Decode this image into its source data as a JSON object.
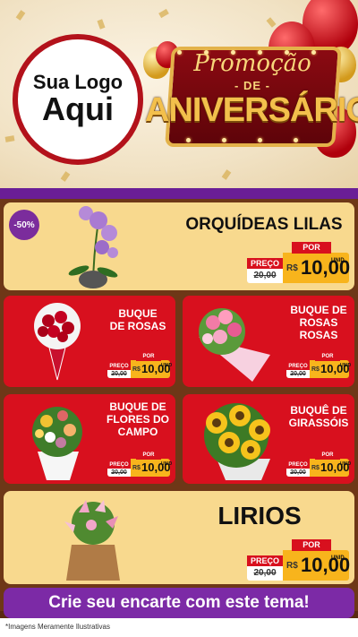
{
  "colors": {
    "brand_red": "#d8101e",
    "purple": "#7c2aa6",
    "cream": "#f8d98e",
    "gold": "#f8b41c",
    "brown": "#6e3717"
  },
  "header": {
    "logo_line1": "Sua Logo",
    "logo_line2": "Aqui",
    "promo_line1": "Promoção",
    "promo_line2": "- DE -",
    "promo_line3": "ANIVERSÁRIO"
  },
  "price_labels": {
    "old_label": "PREÇO",
    "new_label": "POR",
    "currency": "R$",
    "unit": "UNID"
  },
  "products": [
    {
      "name": "ORQUÍDEAS LILAS",
      "discount": "-50%",
      "old_price": "20,00",
      "price": "10,00",
      "icon": "orchid-image"
    },
    {
      "name": "BUQUE\nDE ROSAS",
      "old_price": "20,00",
      "price": "10,00",
      "icon": "rose-bouquet-image"
    },
    {
      "name": "BUQUE DE\nROSAS\nROSAS",
      "old_price": "20,00",
      "price": "10,00",
      "icon": "pink-rose-bouquet-image"
    },
    {
      "name": "BUQUE DE\nFLORES DO\nCAMPO",
      "old_price": "20,00",
      "price": "10,00",
      "icon": "wildflower-bouquet-image"
    },
    {
      "name": "BUQUÊ DE\nGIRASSÓIS",
      "old_price": "20,00",
      "price": "10,00",
      "icon": "sunflower-bouquet-image"
    },
    {
      "name": "LIRIOS",
      "old_price": "20,00",
      "price": "10,00",
      "icon": "lily-bouquet-image"
    }
  ],
  "cta": "Crie seu encarte com este tema!",
  "disclaimer": "*Imagens Meramente Ilustrativas"
}
